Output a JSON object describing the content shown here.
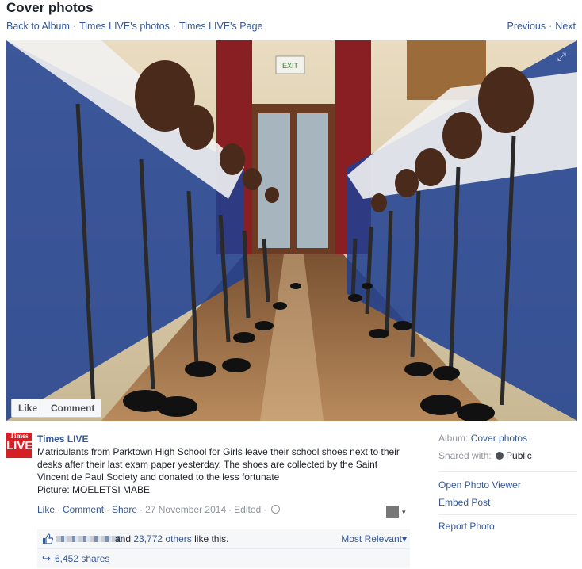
{
  "header": {
    "title": "Cover photos",
    "crumbs": [
      "Back to Album",
      "Times LIVE's photos",
      "Times LIVE's Page"
    ],
    "prev": "Previous",
    "next": "Next"
  },
  "photo": {
    "like_label": "Like",
    "comment_label": "Comment",
    "exit_sign": "EXIT"
  },
  "post": {
    "avatar_top": "Times",
    "avatar_bottom": "LIVE",
    "author": "Times LIVE",
    "body": "Matriculants from Parktown High School for Girls leave their school shoes next to their desks after their last exam paper yesterday. The shoes are collected by the Saint Vincent de Paul Society and donated to the less fortunate\nPicture: MOELETSI MABE",
    "actions": {
      "like": "Like",
      "comment": "Comment",
      "share": "Share",
      "date": "27 November 2014",
      "edited": "Edited"
    }
  },
  "likes": {
    "pre": "and",
    "others": "23,772 others",
    "post": "like this.",
    "sort": "Most Relevant"
  },
  "shares": {
    "count": "6,452 shares"
  },
  "sidebar": {
    "album_label": "Album:",
    "album_value": "Cover photos",
    "shared_label": "Shared with:",
    "shared_value": "Public",
    "open_viewer": "Open Photo Viewer",
    "embed": "Embed Post",
    "report": "Report Photo"
  },
  "colors": {
    "link": "#365899",
    "muted": "#90949c",
    "brand_red": "#d81e25"
  }
}
